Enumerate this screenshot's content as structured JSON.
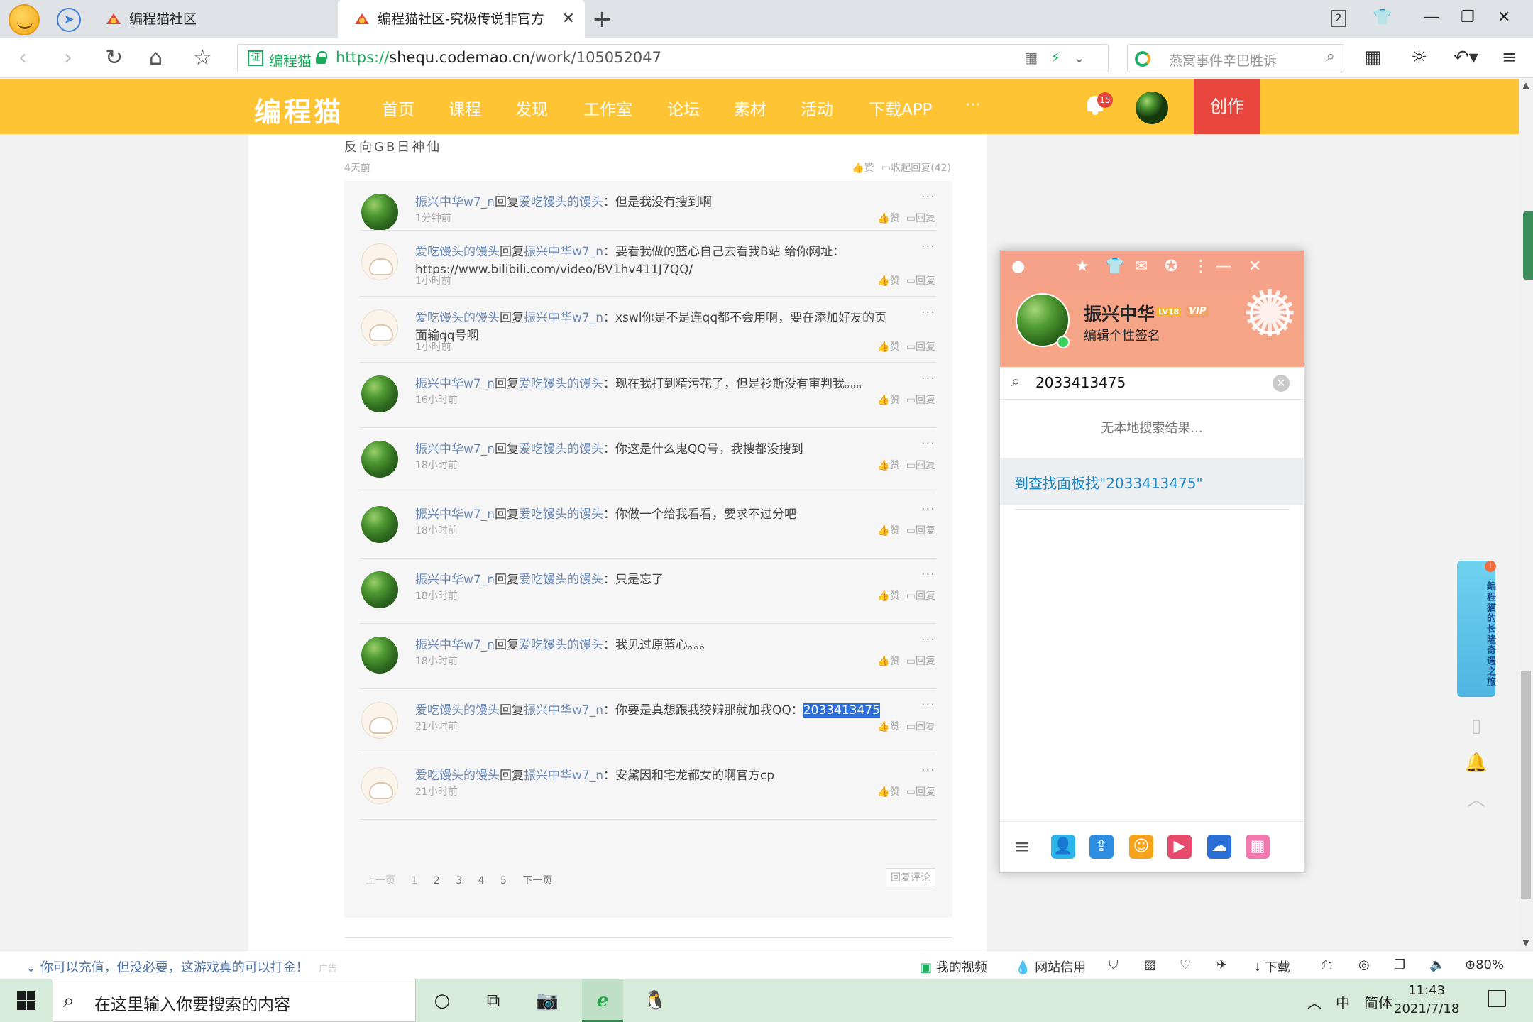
{
  "tabs": [
    {
      "label": "编程猫社区"
    },
    {
      "label": "编程猫社区-究极传说非官方（振兴中华）"
    }
  ],
  "tab_count": "2",
  "address_bar": {
    "site_name": "编程猫",
    "url_scheme": "https://",
    "url_host": "shequ.codemao.cn",
    "url_path": "/work/105052047"
  },
  "search": {
    "placeholder": "燕窝事件辛巴胜诉"
  },
  "site": {
    "logo": "编程猫",
    "nav": [
      "首页",
      "课程",
      "发现",
      "工作室",
      "论坛",
      "素材",
      "活动",
      "下载APP",
      "···"
    ],
    "notification_count": "15",
    "create_label": "创作"
  },
  "parent_comment": {
    "text": "反向GB日神仙",
    "time": "4天前",
    "like": "赞",
    "collapse": "收起回复(42)"
  },
  "replies": [
    {
      "user": "振兴中华w7_n",
      "verb": "回复",
      "target": "爱吃馒头的馒头",
      "text": "但是我没有搜到啊",
      "time": "1分钟前",
      "avatar": "leaf"
    },
    {
      "user": "爱吃馒头的馒头",
      "verb": "回复",
      "target": "振兴中华w7_n",
      "text": "要看我做的蓝心自己去看我B站 给你网址：https://www.bilibili.com/video/BV1hv411J7QQ/",
      "time": "1小时前",
      "avatar": "bun"
    },
    {
      "user": "爱吃馒头的馒头",
      "verb": "回复",
      "target": "振兴中华w7_n",
      "text": "xswl你是不是连qq都不会用啊，要在添加好友的页面输qq号啊",
      "time": "1小时前",
      "avatar": "bun"
    },
    {
      "user": "振兴中华w7_n",
      "verb": "回复",
      "target": "爱吃馒头的馒头",
      "text": "现在我打到精污花了，但是衫斯没有审判我。。。",
      "time": "16小时前",
      "avatar": "leaf"
    },
    {
      "user": "振兴中华w7_n",
      "verb": "回复",
      "target": "爱吃馒头的馒头",
      "text": "你这是什么鬼QQ号，我搜都没搜到",
      "time": "18小时前",
      "avatar": "leaf"
    },
    {
      "user": "振兴中华w7_n",
      "verb": "回复",
      "target": "爱吃馒头的馒头",
      "text": "你做一个给我看看，要求不过分吧",
      "time": "18小时前",
      "avatar": "leaf"
    },
    {
      "user": "振兴中华w7_n",
      "verb": "回复",
      "target": "爱吃馒头的馒头",
      "text": "只是忘了",
      "time": "18小时前",
      "avatar": "leaf"
    },
    {
      "user": "振兴中华w7_n",
      "verb": "回复",
      "target": "爱吃馒头的馒头",
      "text": "我见过原蓝心。。。",
      "time": "18小时前",
      "avatar": "leaf"
    },
    {
      "user": "爱吃馒头的馒头",
      "verb": "回复",
      "target": "振兴中华w7_n",
      "text": "你要是真想跟我狡辩那就加我QQ：",
      "highlight": "2033413475",
      "time": "21小时前",
      "avatar": "bun"
    },
    {
      "user": "爱吃馒头的馒头",
      "verb": "回复",
      "target": "振兴中华w7_n",
      "text": "安黛因和宅龙都女的啊官方cp",
      "time": "21小时前",
      "avatar": "bun"
    }
  ],
  "reply_actions": {
    "like": "赞",
    "reply": "回复",
    "more": "···"
  },
  "pager": {
    "prev": "上一页",
    "pages": [
      "1",
      "2",
      "3",
      "4",
      "5"
    ],
    "next": "下一页",
    "reply_comment": "回复评论"
  },
  "float_banner": {
    "text": "编程猫的长隆奇遇之旅",
    "badge": "!"
  },
  "qq": {
    "name": "振兴中华",
    "level": "LV18",
    "vip": "VIP",
    "signature": "编辑个性签名",
    "search_value": "2033413475",
    "no_result": "无本地搜索结果...",
    "find_link": "到查找面板找\"2033413475\""
  },
  "statusbar": {
    "news": "你可以充值，但没必要，这游戏真的可以打金！",
    "ad": "广告",
    "items": [
      "我的视频",
      "网站信用",
      "下载",
      "80%"
    ]
  },
  "taskbar": {
    "search_placeholder": "在这里输入你要搜索的内容",
    "ime": "中",
    "lang": "简体",
    "time": "11:43",
    "date": "2021/7/18"
  },
  "colors": {
    "site_nav": "#fec433",
    "create": "#e8453c",
    "link_blue": "#6d8ab5",
    "qq_head": "#f6a18a",
    "qq_link": "#1a87c9"
  }
}
